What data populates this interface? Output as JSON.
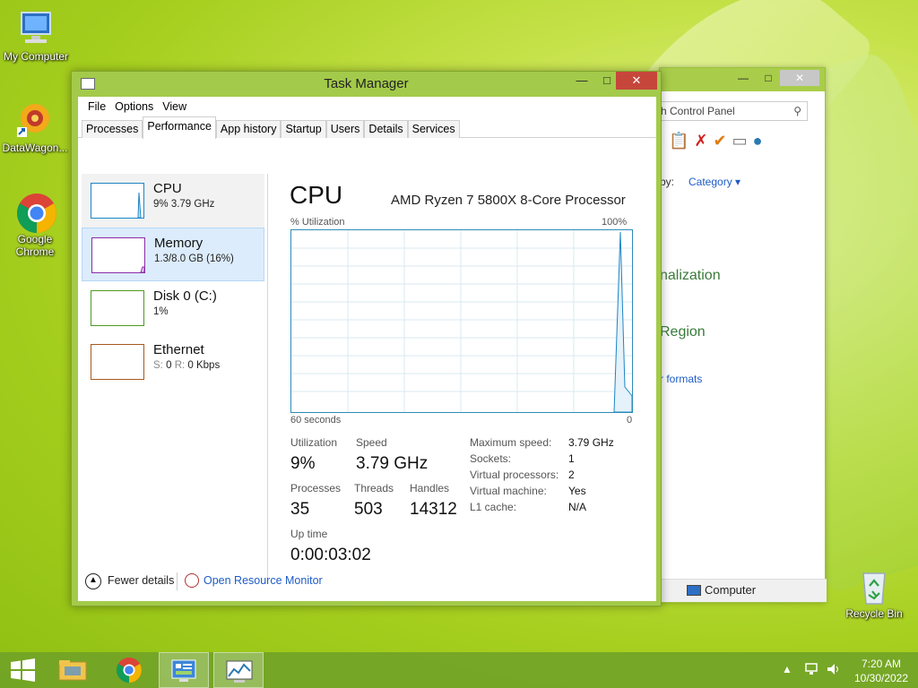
{
  "desktop": {
    "icons": [
      {
        "label": "My Computer"
      },
      {
        "label": "DataWagon..."
      },
      {
        "label": "Google Chrome"
      },
      {
        "label": "Recycle Bin"
      }
    ]
  },
  "control_panel": {
    "search_placeholder": "h Control Panel",
    "view_by_label": "by:",
    "view_by_value": "Category",
    "personalization": "nalization",
    "region": "Region",
    "formats": "r formats",
    "status": "Computer"
  },
  "task_manager": {
    "title": "Task Manager",
    "menu": [
      "File",
      "Options",
      "View"
    ],
    "tabs": [
      "Processes",
      "Performance",
      "App history",
      "Startup",
      "Users",
      "Details",
      "Services"
    ],
    "active_tab": "Performance",
    "resources": [
      {
        "name": "CPU",
        "sub": "9%  3.79 GHz",
        "color": "#1b85c4"
      },
      {
        "name": "Memory",
        "sub": "1.3/8.0 GB (16%)",
        "color": "#8a2ba8"
      },
      {
        "name": "Disk 0 (C:)",
        "sub": "1%",
        "color": "#4d9a20"
      },
      {
        "name": "Ethernet",
        "sub_s_label": "S:",
        "sub_s": "0",
        "sub_r_label": "R:",
        "sub_r": "0 Kbps",
        "color": "#a7591b"
      }
    ],
    "graph": {
      "title": "CPU",
      "processor": "AMD Ryzen 7 5800X 8-Core Processor",
      "ylabel": "% Utilization",
      "ymax_label": "100%",
      "xlabel_left": "60 seconds",
      "xlabel_right": "0"
    },
    "stats": {
      "utilization_label": "Utilization",
      "utilization": "9%",
      "speed_label": "Speed",
      "speed": "3.79 GHz",
      "processes_label": "Processes",
      "processes": "35",
      "threads_label": "Threads",
      "threads": "503",
      "handles_label": "Handles",
      "handles": "14312",
      "uptime_label": "Up time",
      "uptime": "0:00:03:02"
    },
    "specs": [
      {
        "k": "Maximum speed:",
        "v": "3.79 GHz"
      },
      {
        "k": "Sockets:",
        "v": "1"
      },
      {
        "k": "Virtual processors:",
        "v": "2"
      },
      {
        "k": "Virtual machine:",
        "v": "Yes"
      },
      {
        "k": "L1 cache:",
        "v": "N/A"
      }
    ],
    "footer": {
      "fewer_details": "Fewer details",
      "open_resource_monitor": "Open Resource Monitor"
    }
  },
  "taskbar": {
    "time": "7:20 AM",
    "date": "10/30/2022"
  }
}
